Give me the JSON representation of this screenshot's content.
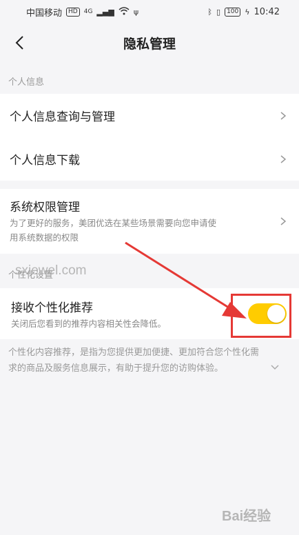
{
  "statusbar": {
    "carrier": "中国移动",
    "hd": "HD",
    "network": "4G",
    "battery": "100",
    "time": "10:42"
  },
  "header": {
    "title": "隐私管理"
  },
  "sections": {
    "personal_info_label": "个人信息",
    "personalization_label": "个性化设置"
  },
  "personal_info_items": [
    {
      "label": "个人信息查询与管理"
    },
    {
      "label": "个人信息下载"
    }
  ],
  "system_permissions": {
    "title": "系统权限管理",
    "description_line1": "为了更好的服务，美团优选在某些场景需要向您申请使",
    "description_line2": "用系统数据的权限"
  },
  "personalized_recommendation": {
    "title": "接收个性化推荐",
    "description": "关闭后您看到的推荐内容相关性会降低。",
    "enabled": true
  },
  "footnote": {
    "line1": "个性化内容推荐，是指为您提供更加便捷、更加符合您个性化需",
    "line2": "求的商品及服务信息展示，有助于提升您的访购体验。"
  },
  "watermarks": {
    "site": "sxiewel.com",
    "brand": "Bai经验"
  },
  "colors": {
    "toggle_on": "#ffcc00",
    "annotation_red": "#e53935",
    "background": "#f5f5f7"
  }
}
